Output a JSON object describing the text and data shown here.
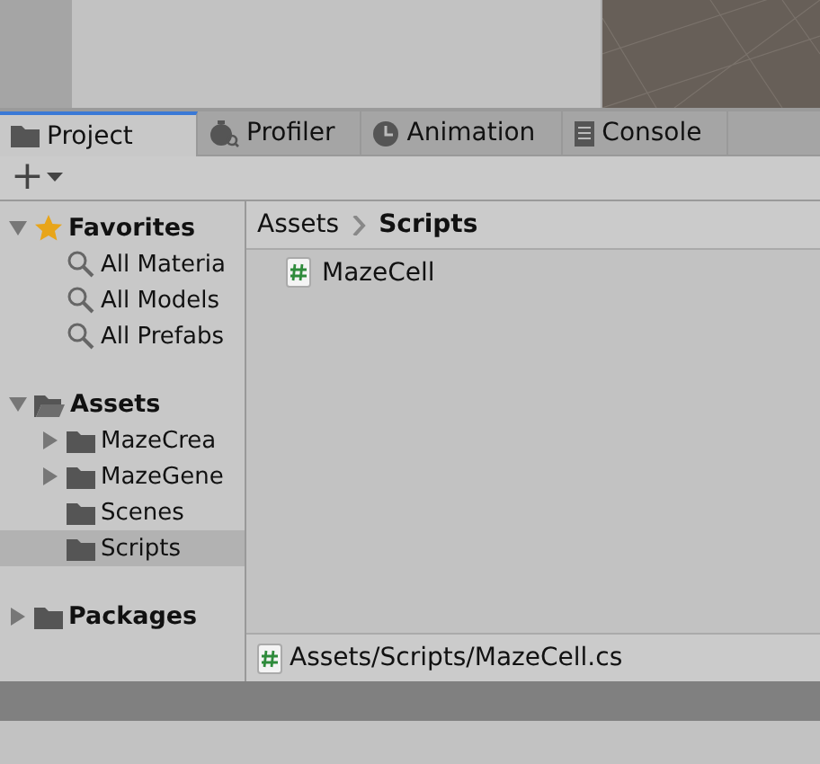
{
  "tabs": [
    {
      "label": "Project",
      "selected": true
    },
    {
      "label": "Profiler",
      "selected": false
    },
    {
      "label": "Animation",
      "selected": false
    },
    {
      "label": "Console",
      "selected": false
    }
  ],
  "toolbar": {
    "add_label": "+"
  },
  "tree": [
    {
      "label": "Favorites",
      "kind": "favorites",
      "expanded": true,
      "selected": false,
      "children": [
        {
          "label": "All Materia",
          "kind": "search",
          "selected": false
        },
        {
          "label": "All Models",
          "kind": "search",
          "selected": false
        },
        {
          "label": "All Prefabs",
          "kind": "search",
          "selected": false
        }
      ]
    },
    {
      "label": "Assets",
      "kind": "folder",
      "expanded": true,
      "selected": false,
      "children": [
        {
          "label": "MazeCrea",
          "kind": "folder",
          "expanded": false,
          "selected": false
        },
        {
          "label": "MazeGene",
          "kind": "folder",
          "expanded": false,
          "selected": false
        },
        {
          "label": "Scenes",
          "kind": "folder",
          "selected": false
        },
        {
          "label": "Scripts",
          "kind": "folder",
          "selected": true
        }
      ]
    },
    {
      "label": "Packages",
      "kind": "folder",
      "expanded": false,
      "selected": false
    }
  ],
  "breadcrumb": [
    "Assets",
    "Scripts"
  ],
  "files": [
    {
      "label": "MazeCell",
      "kind": "script"
    }
  ],
  "status_path": "Assets/Scripts/MazeCell.cs"
}
